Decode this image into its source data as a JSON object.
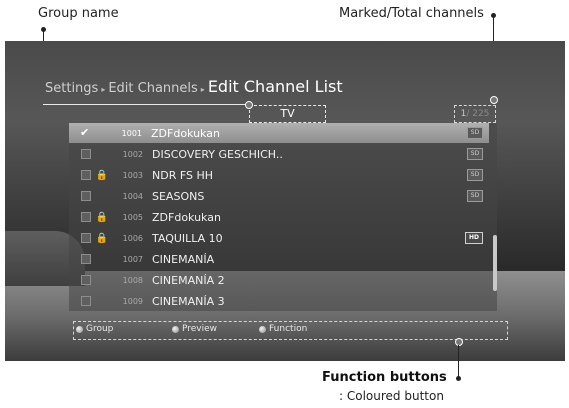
{
  "callouts": {
    "group_name": "Group name",
    "marked_total": "Marked/Total channels",
    "function_buttons": "Function buttons",
    "coloured_button": ": Coloured button"
  },
  "breadcrumb": {
    "settings": "Settings",
    "edit_channels": "Edit Channels",
    "current": "Edit Channel List",
    "separator": "▸"
  },
  "group": {
    "value": "TV"
  },
  "counter": {
    "marked": "1",
    "total": "/ 225"
  },
  "channels": [
    {
      "check": "✔",
      "lock": "",
      "number": "1001",
      "name": "ZDFdokukan",
      "badge": "SD"
    },
    {
      "check": "",
      "lock": "",
      "number": "1002",
      "name": "DISCOVERY GESCHICH..",
      "badge": "SD"
    },
    {
      "check": "",
      "lock": "🔒",
      "number": "1003",
      "name": "NDR FS HH",
      "badge": "SD"
    },
    {
      "check": "",
      "lock": "",
      "number": "1004",
      "name": "SEASONS",
      "badge": "SD"
    },
    {
      "check": "",
      "lock": "🔒",
      "number": "1005",
      "name": "ZDFdokukan",
      "badge": ""
    },
    {
      "check": "",
      "lock": "🔒",
      "number": "1006",
      "name": "TAQUILLA 10",
      "badge": "HD"
    },
    {
      "check": "",
      "lock": "",
      "number": "1007",
      "name": "CINEMANÍA",
      "badge": ""
    },
    {
      "check": "",
      "lock": "",
      "number": "1008",
      "name": "CINEMANÍA 2",
      "badge": ""
    },
    {
      "check": "",
      "lock": "",
      "number": "1009",
      "name": "CINEMANÍA 3",
      "badge": ""
    }
  ],
  "function_bar": {
    "group": "Group",
    "preview": "Preview",
    "function": "Function"
  }
}
